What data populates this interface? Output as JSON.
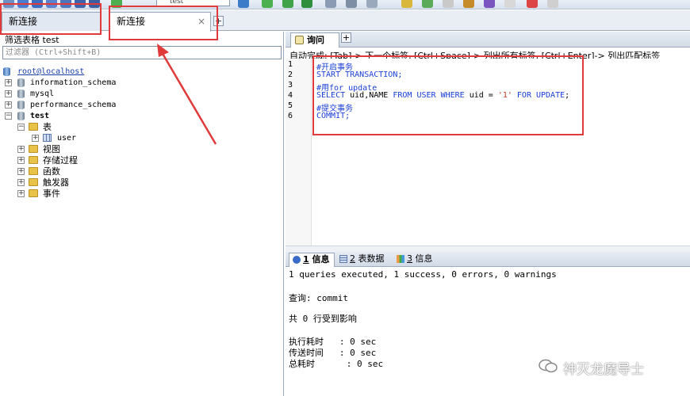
{
  "toolbar": {
    "database_select": "test"
  },
  "connection_tabs": [
    {
      "label": "新连接"
    },
    {
      "label": "新连接",
      "close": "×"
    }
  ],
  "add_tab": "+",
  "object_browser": {
    "filter_title": "筛选表格 test",
    "filter_placeholder": "过滤器 (Ctrl+Shift+B)",
    "root": "root@localhost",
    "databases": [
      "information_schema",
      "mysql",
      "performance_schema"
    ],
    "open_database": "test",
    "tables_folder": "表",
    "table": "user",
    "folders": [
      "视图",
      "存储过程",
      "函数",
      "触发器",
      "事件"
    ]
  },
  "query_tab": {
    "label": "询问",
    "hint": "自动完成: [Tab]-> 下一个标签, [Ctrl+Space]-> 列出所有标签, [Ctrl+Enter]-> 列出匹配标签"
  },
  "editor": {
    "line_numbers": [
      "1",
      "2",
      "3",
      "4",
      "5",
      "6"
    ],
    "lines": {
      "l1": "#开启事务",
      "l2": "START TRANSACTION;",
      "l3": "#用for update",
      "l4_select": "SELECT",
      "l4_cols": " uid,NAME ",
      "l4_from": "FROM",
      "l4_user": " USER ",
      "l4_where": "WHERE",
      "l4_cond": " uid = ",
      "l4_val": "'1'",
      "l4_for": " FOR UPDATE",
      "l4_end": ";",
      "l5": "#提交事务",
      "l6": "COMMIT;"
    }
  },
  "result_tabs": [
    {
      "num": "1",
      "label": " 信息"
    },
    {
      "num": "2",
      "label": " 表数据"
    },
    {
      "num": "3",
      "label": " 信息"
    }
  ],
  "results": {
    "summary": "1 queries executed, 1 success, 0 errors, 0 warnings",
    "query": "查询: commit",
    "affected": "共 0 行受到影响",
    "exec_time": "执行耗时   : 0 sec",
    "transfer_time": "传送时间   : 0 sec",
    "total_time": "总耗时      : 0 sec"
  },
  "watermark": "神灭龙魔导士",
  "colors": {
    "annotation_red": "#e03a3a",
    "keyword_blue": "#1a3fd6",
    "string_red": "#c0392b"
  }
}
